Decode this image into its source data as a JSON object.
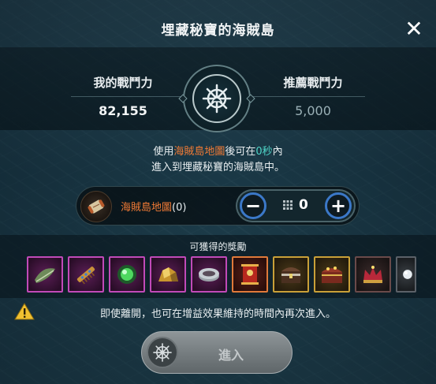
{
  "dialog": {
    "title": "埋藏秘寶的海賊島",
    "close_icon": "close-icon"
  },
  "power": {
    "my_label": "我的戰鬥力",
    "my_value": "82,155",
    "rec_label": "推薦戰鬥力",
    "rec_value": "5,000",
    "emblem_icon": "ship-wheel-icon"
  },
  "info": {
    "prefix": "使用",
    "item": "海賊島地圖",
    "middle": "後可在",
    "time": "0秒",
    "suffix": "內",
    "line2": "進入到埋藏秘寶的海賊島中。"
  },
  "ticket": {
    "name": "海賊島地圖",
    "count": "(0)",
    "icon": "scroll-map-icon",
    "qty": "0",
    "minus": "−",
    "plus": "+"
  },
  "rewards": {
    "title": "可獲得的獎勵",
    "items": [
      {
        "icon": "leaf-bundle-icon",
        "grade": "purple"
      },
      {
        "icon": "comb-icon",
        "grade": "purple"
      },
      {
        "icon": "green-orb-icon",
        "grade": "purple"
      },
      {
        "icon": "gold-ore-icon",
        "grade": "purple"
      },
      {
        "icon": "silver-ring-icon",
        "grade": "purple"
      },
      {
        "icon": "red-scroll-icon",
        "grade": "red"
      },
      {
        "icon": "chest-icon",
        "grade": "gold"
      },
      {
        "icon": "treasure-chest-icon",
        "grade": "gold"
      },
      {
        "icon": "crown-icon",
        "grade": "dark"
      },
      {
        "icon": "pearl-icon",
        "grade": "grey"
      }
    ]
  },
  "warning": {
    "icon": "warning-icon",
    "text": "即使離開，也可在增益效果維持的時間內再次進入。"
  },
  "enter": {
    "label": "進入",
    "icon": "ship-wheel-icon"
  },
  "colors": {
    "highlight": "#f07a35",
    "time": "#4fd6c8",
    "stepper_ring": "#3b78c8"
  }
}
